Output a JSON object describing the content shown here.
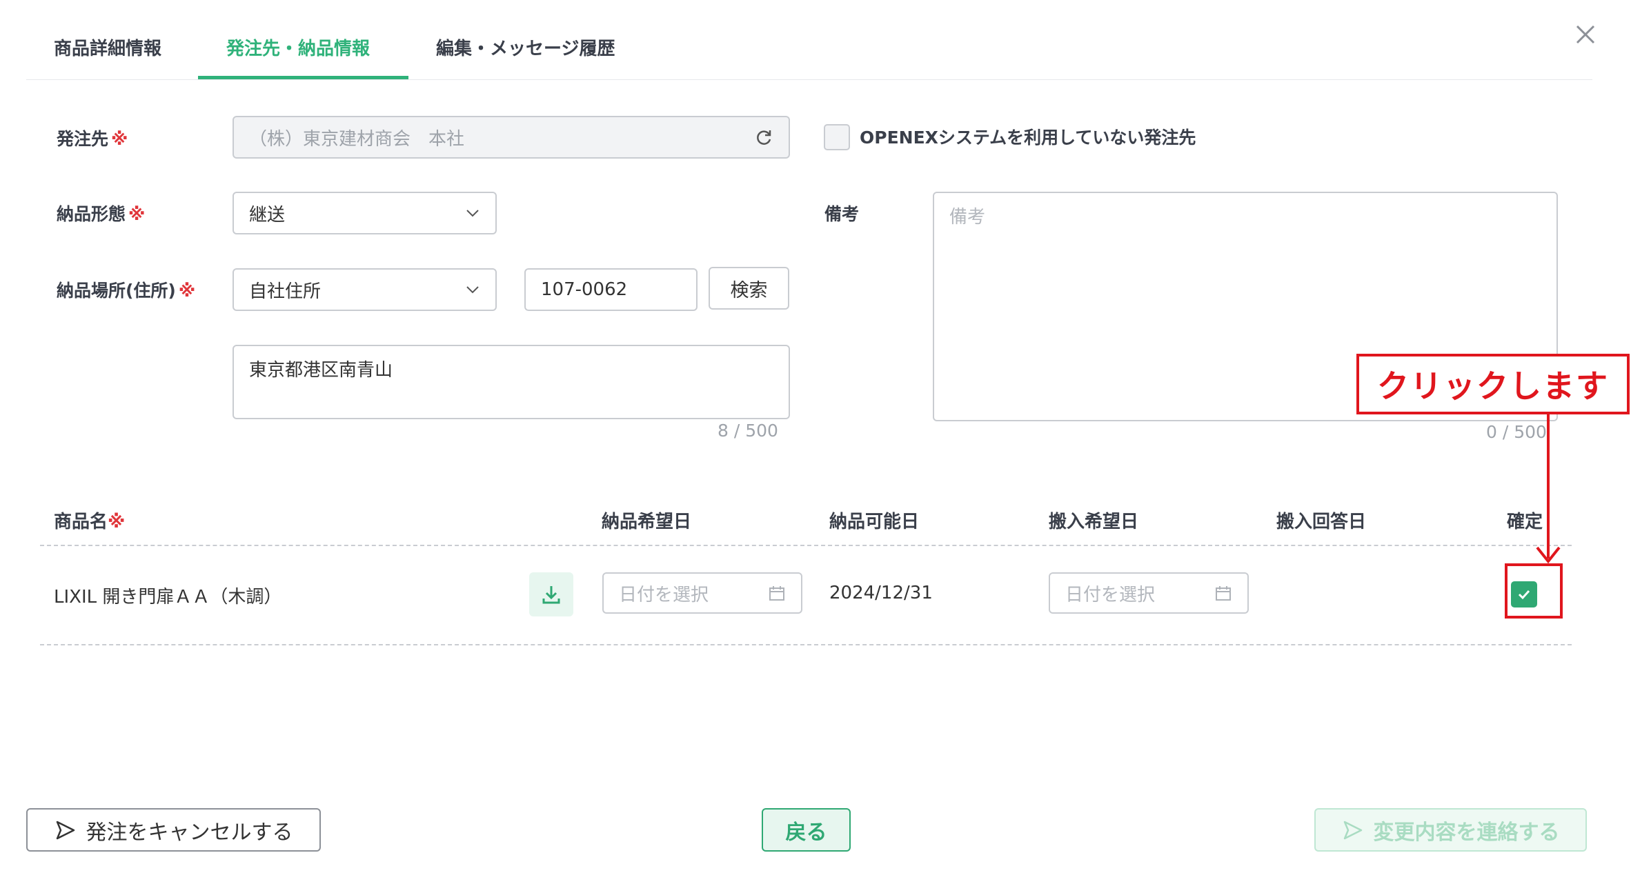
{
  "tabs": [
    {
      "label": "商品詳細情報",
      "active": false
    },
    {
      "label": "発注先・納品情報",
      "active": true
    },
    {
      "label": "編集・メッセージ履歴",
      "active": false
    }
  ],
  "form": {
    "supplier": {
      "label": "発注先",
      "required_mark": "※",
      "value": "（株）東京建材商会　本社"
    },
    "no_openex": {
      "label": "OPENEXシステムを利用していない発注先",
      "checked": false
    },
    "delivery_type": {
      "label": "納品形態",
      "required_mark": "※",
      "value": "継送"
    },
    "notes": {
      "label": "備考",
      "placeholder": "備考",
      "counter": "0 / 500"
    },
    "delivery_place": {
      "label": "納品場所(住所)",
      "required_mark": "※",
      "value": "自社住所"
    },
    "postal_code": {
      "value": "107-0062",
      "search_label": "検索"
    },
    "address": {
      "value": "東京都港区南青山",
      "counter": "8 / 500"
    }
  },
  "table": {
    "headers": {
      "product": "商品名",
      "product_required_mark": "※",
      "desired_delivery": "納品希望日",
      "possible_delivery": "納品可能日",
      "desired_carry_in": "搬入希望日",
      "carry_in_answer": "搬入回答日",
      "confirm": "確定"
    },
    "rows": [
      {
        "product": "LIXIL 開き門扉ＡＡ（木調）",
        "desired_delivery_placeholder": "日付を選択",
        "possible_delivery": "2024/12/31",
        "desired_carry_in_placeholder": "日付を選択",
        "carry_in_answer": "",
        "confirmed": true
      }
    ]
  },
  "annotation": {
    "text": "クリックします",
    "color": "#e0161d"
  },
  "footer": {
    "cancel_label": "発注をキャンセルする",
    "back_label": "戻る",
    "send_label": "変更内容を連絡する"
  },
  "colors": {
    "accent": "#2fb27a",
    "required": "#e0353a",
    "annotation": "#e0161d"
  },
  "icons": [
    "close-icon",
    "refresh-icon",
    "chevron-down-icon",
    "download-icon",
    "calendar-icon",
    "check-icon",
    "send-icon"
  ]
}
